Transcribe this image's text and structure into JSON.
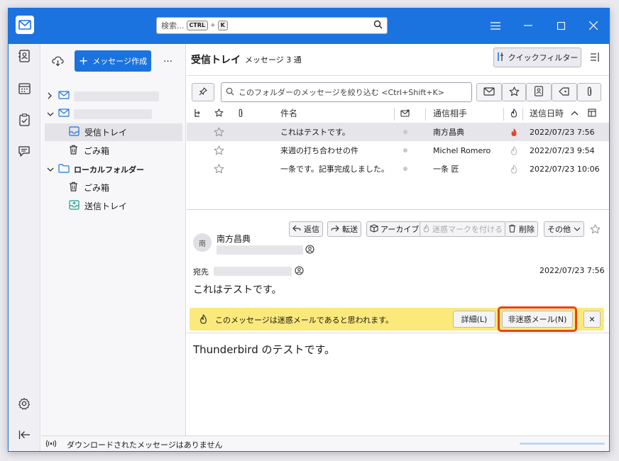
{
  "search": {
    "placeholder": "検索...",
    "key1": "CTRL",
    "plus": "+",
    "key2": "K"
  },
  "compose": {
    "label": "メッセージ作成",
    "more": "…"
  },
  "folders": {
    "local": "ローカルフォルダー",
    "inbox": "受信トレイ",
    "trash": "ごみ箱",
    "sent": "送信トレイ"
  },
  "header": {
    "title": "受信トレイ",
    "count": "メッセージ 3 通",
    "quick_filter": "クイックフィルター"
  },
  "filter": {
    "placeholder": "このフォルダーのメッセージを絞り込む <Ctrl+Shift+K>"
  },
  "columns": {
    "subject": "件名",
    "correspondent": "通信相手",
    "date": "送信日時"
  },
  "messages": [
    {
      "subject": "これはテストです。",
      "from": "南方昌典",
      "date": "2022/07/23 7:56",
      "junk": true
    },
    {
      "subject": "来週の打ち合わせの件",
      "from": "Michel Romero",
      "date": "2022/07/23 9:54",
      "junk": false
    },
    {
      "subject": "一条です。記事完成しました。",
      "from": "一条 匠",
      "date": "2022/07/23 10:06",
      "junk": false
    }
  ],
  "actions": {
    "reply": "返信",
    "forward": "転送",
    "archive": "アーカイブ",
    "junk": "迷惑マークを付ける",
    "delete": "削除",
    "more": "その他"
  },
  "message": {
    "avatar": "南",
    "sender": "南方昌典",
    "to_label": "宛先",
    "date": "2022/07/23 7:56",
    "subject": "これはテストです。",
    "body": "Thunderbird のテストです。"
  },
  "junkbar": {
    "text": "このメッセージは迷惑メールであると思われます。",
    "details": "詳細(L)",
    "not_junk": "非迷惑メール(N)",
    "close": "✕"
  },
  "status": {
    "text": "ダウンロードされたメッセージはありません"
  },
  "colors": {
    "accent": "#1b73e0",
    "junkbar": "#fbe97b",
    "highlight": "#e8431c",
    "junk_flame": "#e5432b"
  }
}
